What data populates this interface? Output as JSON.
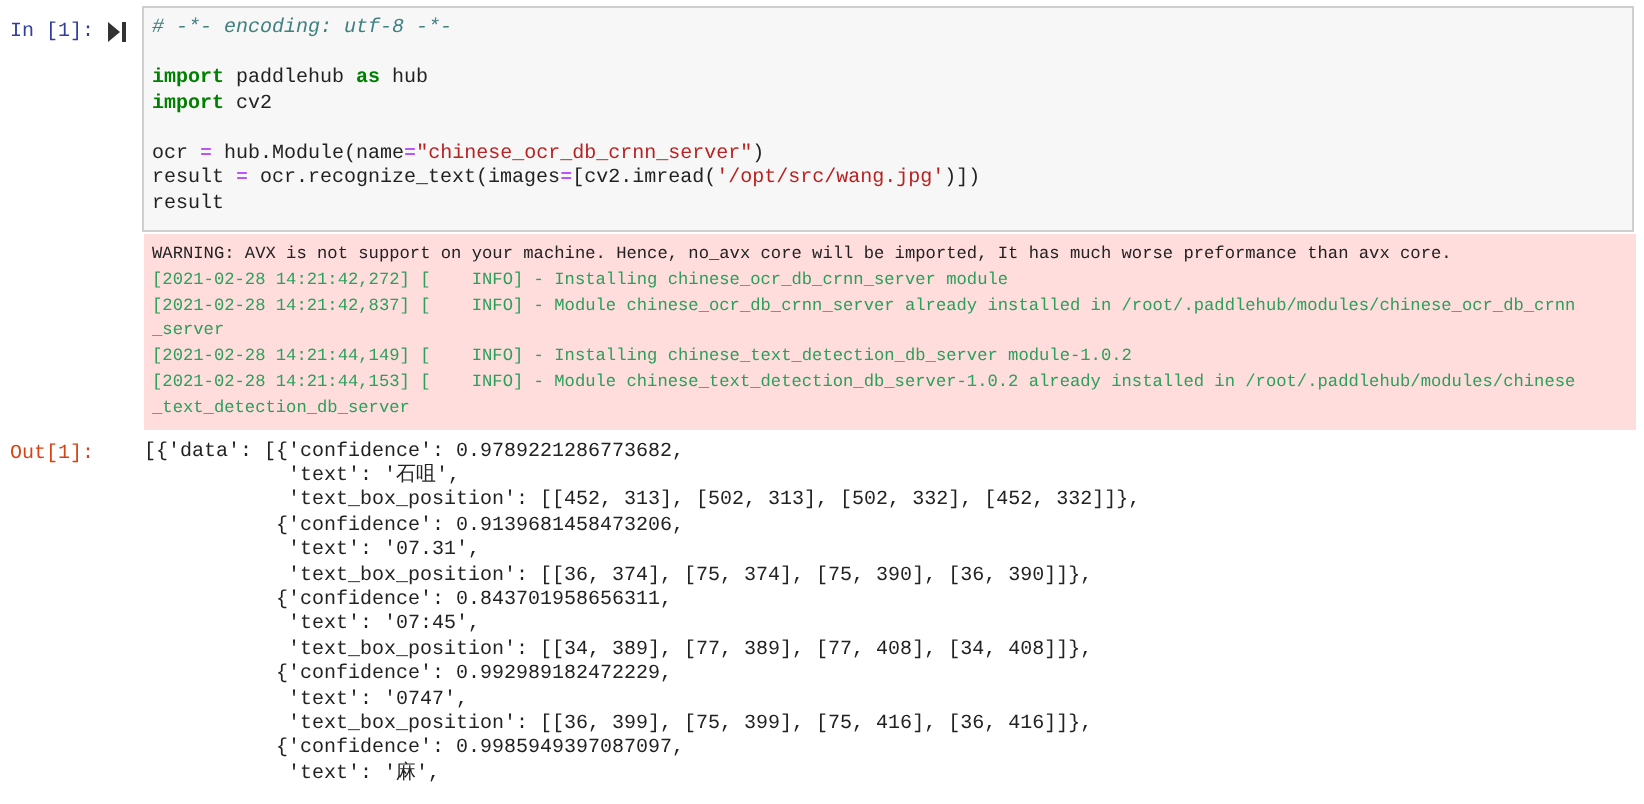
{
  "input_cell": {
    "prompt": "In [1]:",
    "code": [
      {
        "gap_before": false,
        "tokens": [
          {
            "kind": "comment",
            "text": "# -*- encoding: utf-8 -*-"
          }
        ]
      },
      {
        "gap_before": true,
        "tokens": [
          {
            "kind": "keyword",
            "text": "import"
          },
          {
            "kind": "plain",
            "text": " paddlehub "
          },
          {
            "kind": "keyword",
            "text": "as"
          },
          {
            "kind": "plain",
            "text": " hub"
          }
        ]
      },
      {
        "gap_before": false,
        "tokens": [
          {
            "kind": "keyword",
            "text": "import"
          },
          {
            "kind": "plain",
            "text": " cv2"
          }
        ]
      },
      {
        "gap_before": true,
        "tokens": [
          {
            "kind": "plain",
            "text": "ocr "
          },
          {
            "kind": "operator",
            "text": "="
          },
          {
            "kind": "plain",
            "text": " hub.Module(name"
          },
          {
            "kind": "operator",
            "text": "="
          },
          {
            "kind": "string",
            "text": "\"chinese_ocr_db_crnn_server\""
          },
          {
            "kind": "plain",
            "text": ")"
          }
        ]
      },
      {
        "gap_before": false,
        "tokens": [
          {
            "kind": "plain",
            "text": "result "
          },
          {
            "kind": "operator",
            "text": "="
          },
          {
            "kind": "plain",
            "text": " ocr.recognize_text(images"
          },
          {
            "kind": "operator",
            "text": "="
          },
          {
            "kind": "plain",
            "text": "[cv2.imread("
          },
          {
            "kind": "string",
            "text": "'/opt/src/wang.jpg'"
          },
          {
            "kind": "plain",
            "text": ")])"
          }
        ]
      },
      {
        "gap_before": false,
        "tokens": [
          {
            "kind": "plain",
            "text": "result"
          }
        ]
      }
    ]
  },
  "stderr": [
    {
      "kind": "warning",
      "text": "WARNING: AVX is not support on your machine. Hence, no_avx core will be imported, It has much worse preformance than avx core."
    },
    {
      "kind": "info",
      "text": "[2021-02-28 14:21:42,272] [    INFO] - Installing chinese_ocr_db_crnn_server module"
    },
    {
      "kind": "info",
      "text": "[2021-02-28 14:21:42,837] [    INFO] - Module chinese_ocr_db_crnn_server already installed in /root/.paddlehub/modules/chinese_ocr_db_crnn"
    },
    {
      "kind": "info",
      "text": "_server"
    },
    {
      "kind": "info",
      "text": "[2021-02-28 14:21:44,149] [    INFO] - Installing chinese_text_detection_db_server module-1.0.2"
    },
    {
      "kind": "info",
      "text": "[2021-02-28 14:21:44,153] [    INFO] - Module chinese_text_detection_db_server-1.0.2 already installed in /root/.paddlehub/modules/chinese"
    },
    {
      "kind": "info",
      "text": "_text_detection_db_server"
    }
  ],
  "output_cell": {
    "prompt": "Out[1]:",
    "lines": [
      "[{'data': [{'confidence': 0.9789221286773682,",
      "            'text': '石咀',",
      "            'text_box_position': [[452, 313], [502, 313], [502, 332], [452, 332]]},",
      "           {'confidence': 0.9139681458473206,",
      "            'text': '07.31',",
      "            'text_box_position': [[36, 374], [75, 374], [75, 390], [36, 390]]},",
      "           {'confidence': 0.843701958656311,",
      "            'text': '07:45',",
      "            'text_box_position': [[34, 389], [77, 389], [77, 408], [34, 408]]},",
      "           {'confidence': 0.992989182472229,",
      "            'text': '0747',",
      "            'text_box_position': [[36, 399], [75, 399], [75, 416], [36, 416]]},",
      "           {'confidence': 0.9985949397087097,",
      "            'text': '麻',"
    ]
  }
}
